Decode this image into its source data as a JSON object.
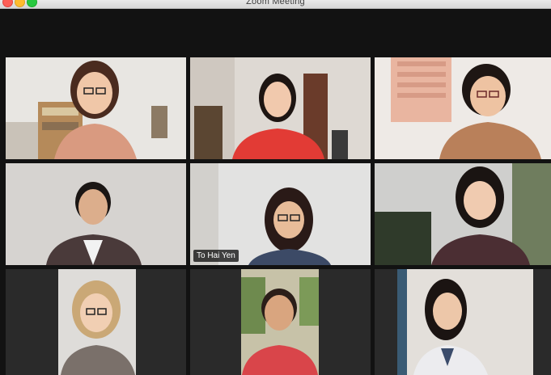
{
  "window": {
    "title": "Zoom Meeting"
  },
  "gallery": {
    "active_speaker": "To Hai Yen",
    "participants": [
      {
        "id": "p1",
        "name": "",
        "shirt_color": "#d99a80",
        "wall_color": "#e8e6e2"
      },
      {
        "id": "p2",
        "name": "",
        "shirt_color": "#e23b35",
        "wall_color": "#ded9d3"
      },
      {
        "id": "p3",
        "name": "",
        "shirt_color": "#b9805a",
        "wall_color": "#eeeae6"
      },
      {
        "id": "p4",
        "name": "",
        "shirt_color": "#4a3a3a",
        "wall_color": "#d6d3d0"
      },
      {
        "id": "p5",
        "name": "To Hai Yen",
        "shirt_color": "#3c4a66",
        "wall_color": "#e2e2e1"
      },
      {
        "id": "p6",
        "name": "",
        "shirt_color": "#4b2e33",
        "wall_color": "#cfcfcd"
      },
      {
        "id": "p7",
        "name": "",
        "shirt_color": "#7a706a",
        "wall_color": "#dedcd9"
      },
      {
        "id": "p8",
        "name": "",
        "shirt_color": "#d9454a",
        "wall_color": "#c7c2a8"
      },
      {
        "id": "p9",
        "name": "",
        "shirt_color": "#ececef",
        "wall_color": "#e3dfda"
      }
    ]
  },
  "colors": {
    "background": "#121212",
    "active_border": "#d7e56a",
    "label_bg": "#000000"
  }
}
